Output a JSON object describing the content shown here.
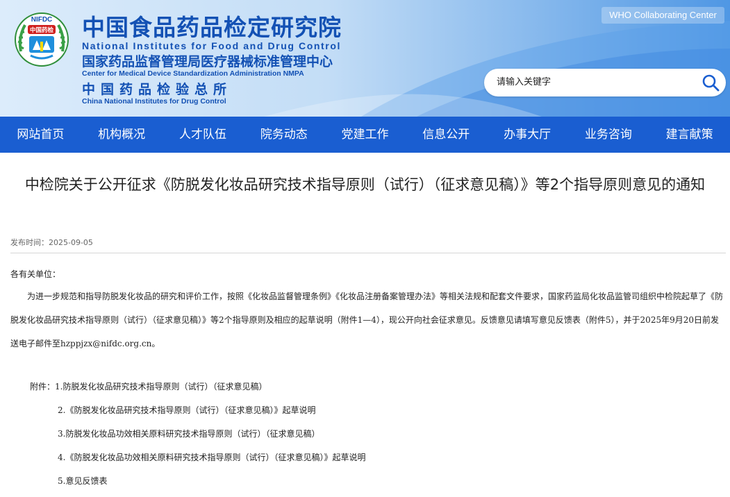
{
  "header": {
    "logo_text_top": "NIFDC",
    "logo_text_badge": "中国药检",
    "cn_title": "中国食品药品检定研究院",
    "en_title": "National Institutes for Food and Drug Control",
    "cn_sub": "国家药品监督管理局医疗器械标准管理中心",
    "en_sub": "Center for Medical Device Standardization Administration NMPA",
    "cn_third": "中国药品检验总所",
    "en_third": "China National Institutes for Drug Control",
    "who_badge": "WHO Collaborating Center",
    "search_placeholder": "请输入关键字",
    "search_icon": "search-icon",
    "colors": {
      "brand_blue": "#1351b4",
      "nav_blue": "#1a5ed1"
    }
  },
  "nav": {
    "items": [
      "网站首页",
      "机构概况",
      "人才队伍",
      "院务动态",
      "党建工作",
      "信息公开",
      "办事大厅",
      "业务咨询",
      "建言献策"
    ]
  },
  "article": {
    "title": "中检院关于公开征求《防脱发化妆品研究技术指导原则（试行）（征求意见稿）》等2个指导原则意见的通知",
    "date": "发布时间：2025-09-05",
    "greeting": "各有关单位：",
    "paragraph": "为进一步规范和指导防脱发化妆品的研究和评价工作，按照《化妆品监督管理条例》《化妆品注册备案管理办法》等相关法规和配套文件要求，国家药监局化妆品监管司组织中检院起草了《防脱发化妆品研究技术指导原则（试行）（征求意见稿）》等2个指导原则及相应的起草说明（附件1—4），现公开向社会征求意见。反馈意见请填写意见反馈表（附件5），并于2025年9月20日前发送电子邮件至hzppjzx@nifdc.org.cn。",
    "attachments": [
      "附件：1.防脱发化妆品研究技术指导原则（试行）（征求意见稿）",
      "2.《防脱发化妆品研究技术指导原则（试行）（征求意见稿）》起草说明",
      "3.防脱发化妆品功效相关原料研究技术指导原则（试行）（征求意见稿）",
      "4.《防脱发化妆品功效相关原料研究技术指导原则（试行）（征求意见稿）》起草说明",
      "5.意见反馈表"
    ]
  }
}
